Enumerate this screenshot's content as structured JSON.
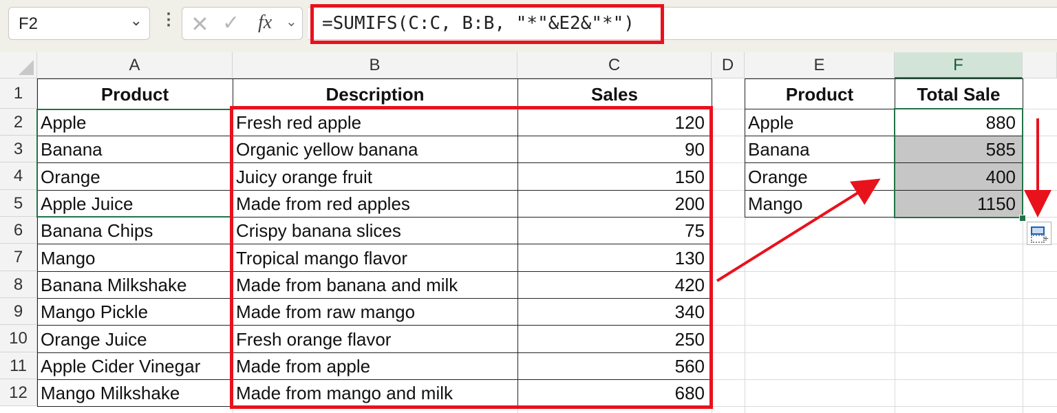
{
  "name_box": {
    "value": "F2"
  },
  "formula_bar": {
    "formula": "=SUMIFS(C:C, B:B, \"*\"&E2&\"*\")",
    "fx_label": "fx"
  },
  "columns": [
    "A",
    "B",
    "C",
    "D",
    "E",
    "F"
  ],
  "selected_column": "F",
  "rows": [
    "1",
    "2",
    "3",
    "4",
    "5",
    "6",
    "7",
    "8",
    "9",
    "10",
    "11",
    "12"
  ],
  "main_table": {
    "headers": [
      "Product",
      "Description",
      "Sales"
    ],
    "rows": [
      [
        "Apple",
        "Fresh red apple",
        "120"
      ],
      [
        "Banana",
        "Organic yellow banana",
        "90"
      ],
      [
        "Orange",
        "Juicy orange fruit",
        "150"
      ],
      [
        "Apple Juice",
        "Made from red apples",
        "200"
      ],
      [
        "Banana Chips",
        "Crispy banana slices",
        "75"
      ],
      [
        "Mango",
        "Tropical mango flavor",
        "130"
      ],
      [
        "Banana Milkshake",
        "Made from banana and milk",
        "420"
      ],
      [
        "Mango Pickle",
        "Made from raw mango",
        "340"
      ],
      [
        "Orange Juice",
        "Fresh orange flavor",
        "250"
      ],
      [
        "Apple Cider Vinegar",
        "Made from apple",
        "560"
      ],
      [
        "Mango Milkshake",
        "Made from mango and milk",
        "680"
      ]
    ]
  },
  "summary_table": {
    "headers": [
      "Product",
      "Total Sale"
    ],
    "rows": [
      [
        "Apple",
        "880"
      ],
      [
        "Banana",
        "585"
      ],
      [
        "Orange",
        "400"
      ],
      [
        "Mango",
        "1150"
      ]
    ]
  },
  "colors": {
    "highlight_red": "#e8121d",
    "selection_green": "#217346",
    "fill_shade": "#c6c6c6"
  }
}
